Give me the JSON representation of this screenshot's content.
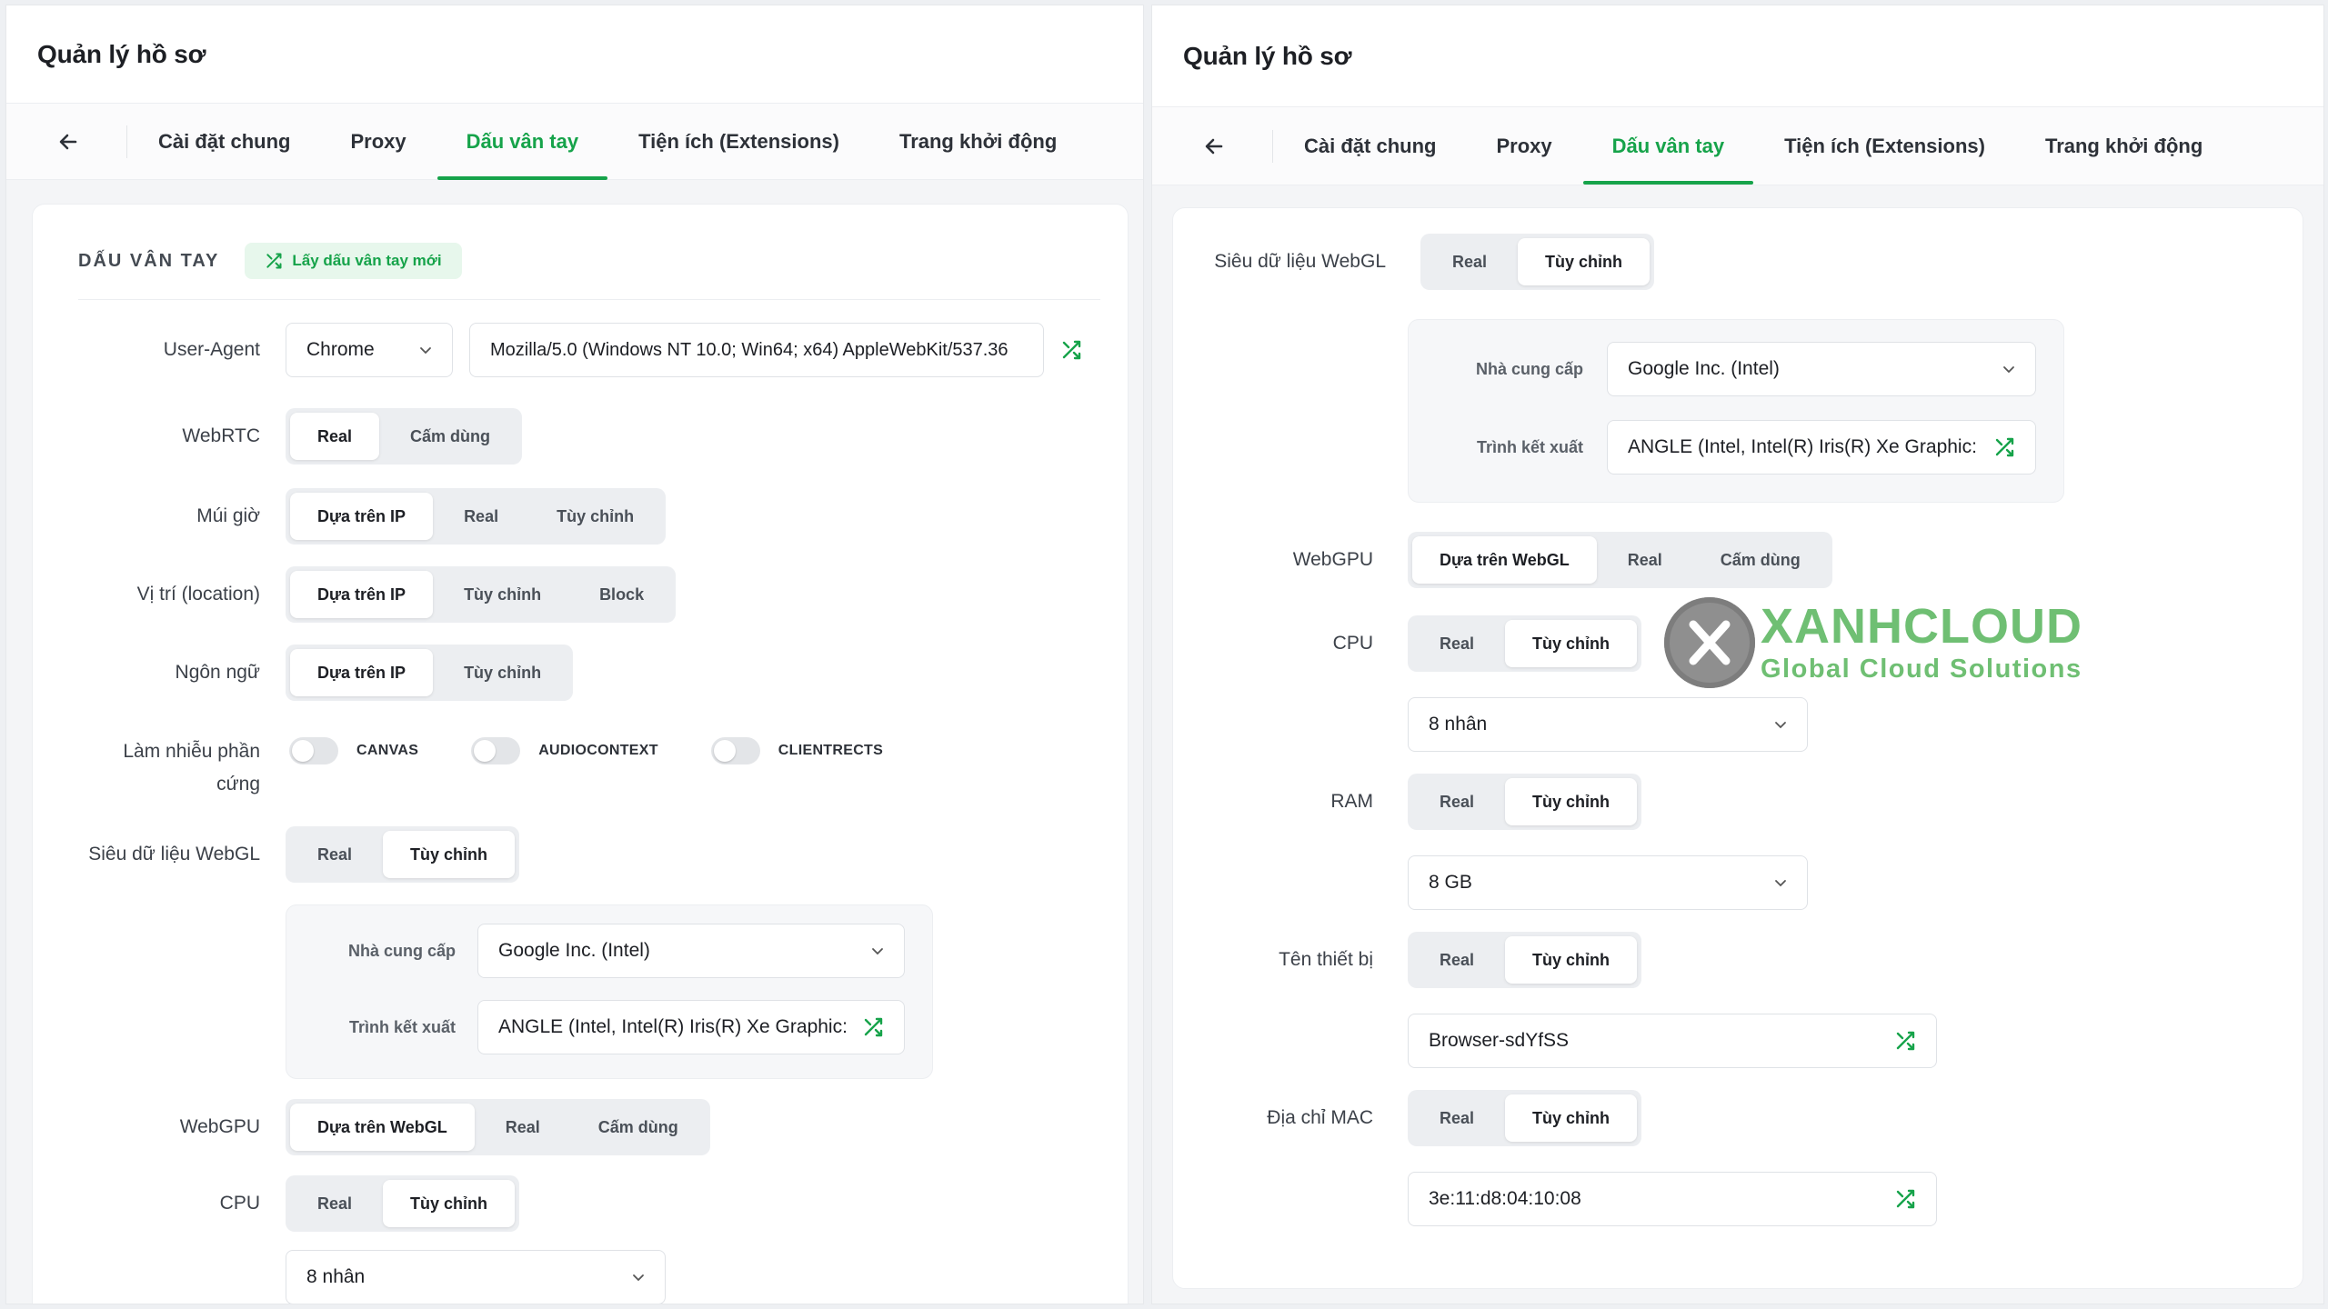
{
  "app_title": "Quản lý hồ sơ",
  "tabs": [
    "Cài đặt chung",
    "Proxy",
    "Dấu vân tay",
    "Tiện ích (Extensions)",
    "Trang khởi động"
  ],
  "active_tab": "Dấu vân tay",
  "section": {
    "title": "DẤU VÂN TAY",
    "new_fingerprint_button": "Lấy dấu vân tay mới"
  },
  "user_agent": {
    "label": "User-Agent",
    "browser": "Chrome",
    "value": "Mozilla/5.0 (Windows NT 10.0; Win64; x64) AppleWebKit/537.36"
  },
  "webrtc": {
    "label": "WebRTC",
    "options": [
      "Real",
      "Cấm dùng"
    ],
    "selected": "Real"
  },
  "timezone": {
    "label": "Múi giờ",
    "options": [
      "Dựa trên IP",
      "Real",
      "Tùy chỉnh"
    ],
    "selected": "Dựa trên IP"
  },
  "location": {
    "label": "Vị trí (location)",
    "options": [
      "Dựa trên IP",
      "Tùy chỉnh",
      "Block"
    ],
    "selected": "Dựa trên IP"
  },
  "language": {
    "label": "Ngôn ngữ",
    "options": [
      "Dựa trên IP",
      "Tùy chỉnh"
    ],
    "selected": "Dựa trên IP"
  },
  "hardware_noise": {
    "label_line1": "Làm nhiễu phần",
    "label_line2": "cứng",
    "toggles": [
      {
        "name": "CANVAS",
        "on": false
      },
      {
        "name": "AUDIOCONTEXT",
        "on": false
      },
      {
        "name": "CLIENTRECTS",
        "on": false
      }
    ]
  },
  "webgl": {
    "label": "Siêu dữ liệu WebGL",
    "options": [
      "Real",
      "Tùy chỉnh"
    ],
    "selected": "Tùy chỉnh",
    "vendor_label": "Nhà cung cấp",
    "vendor": "Google Inc. (Intel)",
    "renderer_label": "Trình kết xuất",
    "renderer": "ANGLE (Intel, Intel(R) Iris(R) Xe Graphic:"
  },
  "webgpu": {
    "label": "WebGPU",
    "options": [
      "Dựa trên WebGL",
      "Real",
      "Cấm dùng"
    ],
    "selected": "Dựa trên WebGL"
  },
  "cpu": {
    "label": "CPU",
    "options": [
      "Real",
      "Tùy chỉnh"
    ],
    "selected": "Tùy chỉnh",
    "value": "8 nhân"
  },
  "ram": {
    "label": "RAM",
    "options": [
      "Real",
      "Tùy chỉnh"
    ],
    "selected": "Tùy chỉnh",
    "value": "8 GB"
  },
  "device_name": {
    "label": "Tên thiết bị",
    "options": [
      "Real",
      "Tùy chỉnh"
    ],
    "selected": "Tùy chỉnh",
    "value": "Browser-sdYfSS"
  },
  "mac": {
    "label": "Địa chỉ MAC",
    "options": [
      "Real",
      "Tùy chỉnh"
    ],
    "selected": "Tùy chỉnh",
    "value": "3e:11:d8:04:10:08"
  },
  "logo": {
    "brand": "XANHCLOUD",
    "tagline": "Global Cloud Solutions"
  },
  "colors": {
    "accent": "#16a34a",
    "accent_light": "#e7f7ec",
    "logo_green": "#6fbf73"
  }
}
